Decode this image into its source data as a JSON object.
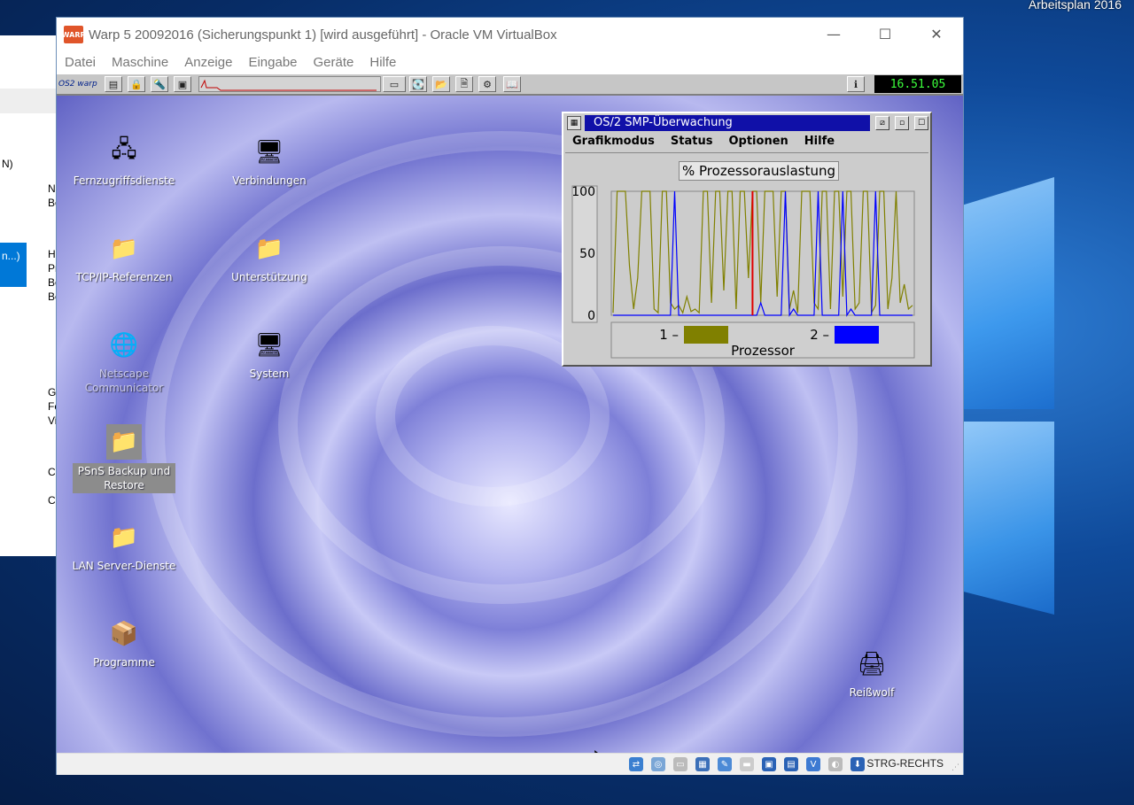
{
  "host": {
    "top_right_label": "Arbeitsplan 2016",
    "bg_window": {
      "snippets": [
        "N)",
        "Na",
        "Be",
        "Ha",
        "Pr",
        "Bo",
        "Be",
        "Gi",
        "Fe",
        "Vi",
        "Cı",
        "Cı"
      ],
      "selected_label": "n...)"
    }
  },
  "vbox": {
    "app_icon_text": "WARP",
    "title": "Warp 5 20092016 (Sicherungspunkt 1) [wird ausgeführt] - Oracle VM VirtualBox",
    "caption": {
      "minimize": "—",
      "maximize": "☐",
      "close": "✕"
    },
    "menu": [
      "Datei",
      "Maschine",
      "Anzeige",
      "Eingabe",
      "Geräte",
      "Hilfe"
    ],
    "status": {
      "host_key": "STRG-RECHTS"
    }
  },
  "warpcenter": {
    "logo": "OS2 warp",
    "clock": "16.51.05"
  },
  "desktop_icons": [
    {
      "name": "icon-fernzugriffsdienste",
      "label": "Fernzugriffsdienste",
      "glyph": "🖧"
    },
    {
      "name": "icon-verbindungen",
      "label": "Verbindungen",
      "glyph": "🖥"
    },
    {
      "name": "icon-tcpip-referenzen",
      "label": "TCP/IP-Referenzen",
      "glyph": "📁"
    },
    {
      "name": "icon-unterstuetzung",
      "label": "Unterstützung",
      "glyph": "📁"
    },
    {
      "name": "icon-netscape-communicator",
      "label": "Netscape Communicator",
      "glyph": "🌐"
    },
    {
      "name": "icon-system",
      "label": "System",
      "glyph": "🖥"
    },
    {
      "name": "icon-psns-backup",
      "label": "PSnS Backup und Restore",
      "glyph": "📁"
    },
    {
      "name": "icon-lan-server-dienste",
      "label": "LAN Server-Dienste",
      "glyph": "📁"
    },
    {
      "name": "icon-programme",
      "label": "Programme",
      "glyph": "📦"
    },
    {
      "name": "icon-reisswolf",
      "label": "Reißwolf",
      "glyph": "🖨"
    }
  ],
  "smp_monitor": {
    "title": "OS/2 SMP-Überwachung",
    "menu": [
      "Grafikmodus",
      "Status",
      "Optionen",
      "Hilfe"
    ],
    "legend_footer": "Prozessor",
    "legend": [
      {
        "label": "1 –",
        "color": "#808000"
      },
      {
        "label": "2 –",
        "color": "#0000ff"
      }
    ]
  },
  "chart_data": {
    "type": "line",
    "title": "% Prozessorauslastung",
    "xlabel": "Prozessor",
    "ylabel": "",
    "ylim": [
      0,
      100
    ],
    "yticks": [
      0,
      50,
      100
    ],
    "grid": false,
    "legend_position": "bottom",
    "cursor_index": 34,
    "series": [
      {
        "name": "1",
        "color": "#808000",
        "values": [
          2,
          100,
          100,
          100,
          40,
          5,
          30,
          100,
          100,
          100,
          5,
          2,
          100,
          100,
          10,
          5,
          8,
          2,
          15,
          3,
          5,
          2,
          100,
          100,
          10,
          100,
          100,
          20,
          100,
          100,
          5,
          100,
          100,
          30,
          100,
          100,
          10,
          100,
          100,
          100,
          15,
          100,
          100,
          5,
          20,
          2,
          100,
          100,
          100,
          10,
          5,
          100,
          100,
          5,
          100,
          100,
          15,
          100,
          100,
          5,
          10,
          100,
          100,
          2,
          8,
          100,
          100,
          5,
          30,
          100,
          10,
          25,
          5,
          8
        ]
      },
      {
        "name": "2",
        "color": "#0000ff",
        "values": [
          0,
          0,
          0,
          0,
          0,
          0,
          0,
          0,
          0,
          0,
          0,
          0,
          0,
          0,
          0,
          100,
          0,
          0,
          0,
          0,
          0,
          0,
          0,
          0,
          0,
          0,
          0,
          0,
          0,
          0,
          0,
          0,
          0,
          0,
          0,
          0,
          10,
          0,
          0,
          0,
          0,
          0,
          100,
          0,
          5,
          0,
          0,
          0,
          0,
          0,
          100,
          0,
          0,
          0,
          0,
          0,
          100,
          0,
          5,
          0,
          0,
          0,
          0,
          0,
          100,
          0,
          0,
          0,
          0,
          0,
          0,
          0,
          0,
          0
        ]
      }
    ]
  }
}
